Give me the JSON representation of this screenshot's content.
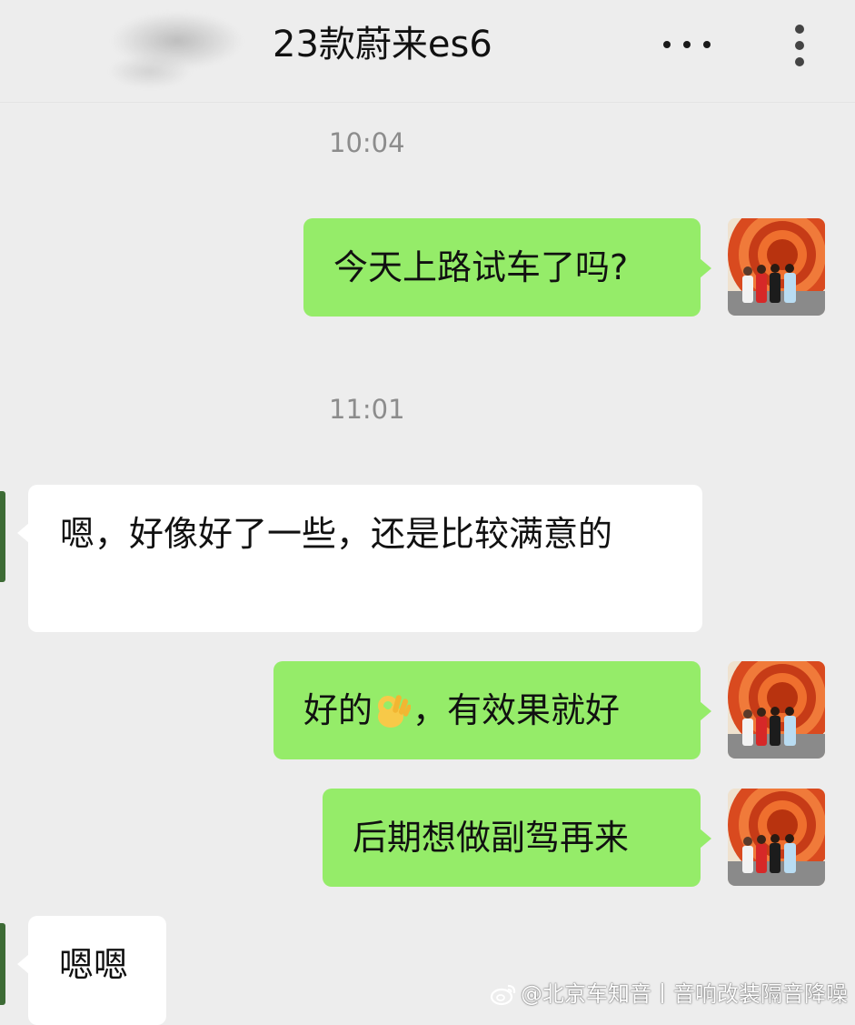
{
  "header": {
    "title": "23款蔚来es6",
    "more_icon": "more-horizontal-icon",
    "menu_icon": "more-vertical-icon"
  },
  "messages": [
    {
      "type": "time",
      "text": "10:04"
    },
    {
      "type": "outgoing",
      "text": "今天上路试车了吗?"
    },
    {
      "type": "time",
      "text": "11:01"
    },
    {
      "type": "incoming",
      "text": "嗯，好像好了一些，还是比较满意的"
    },
    {
      "type": "outgoing",
      "text_before": "好的",
      "emoji": "ok-hand-emoji",
      "text_after": "，有效果就好"
    },
    {
      "type": "outgoing",
      "text": "后期想做副驾再来"
    },
    {
      "type": "incoming",
      "text": "嗯嗯"
    }
  ],
  "watermark": {
    "text": "@北京车知音丨音响改装隔音降噪",
    "icon": "weibo-icon"
  },
  "colors": {
    "background": "#ededed",
    "outgoing_bubble": "#95ec69",
    "incoming_bubble": "#ffffff",
    "timestamp": "#8c8c8c"
  }
}
